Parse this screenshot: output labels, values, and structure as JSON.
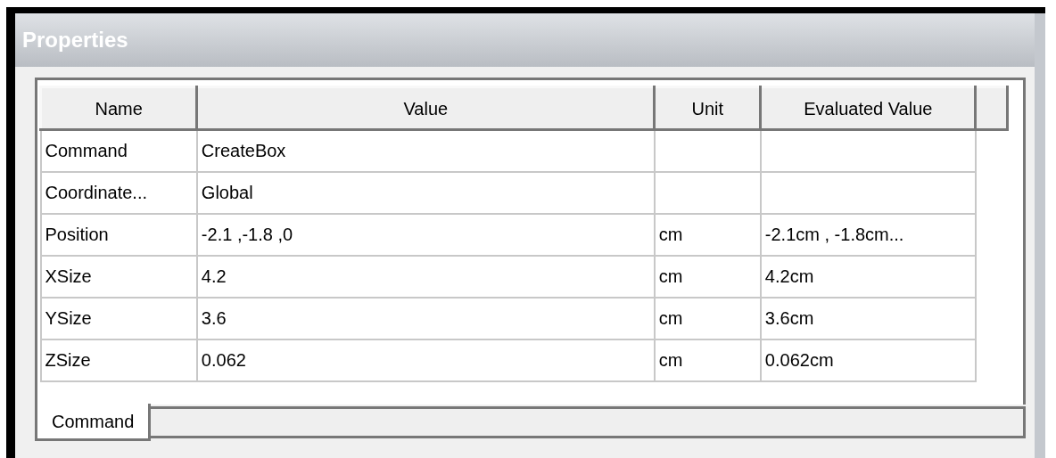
{
  "window": {
    "title": "Properties"
  },
  "table": {
    "columns": [
      "Name",
      "Value",
      "Unit",
      "Evaluated Value"
    ],
    "rows": [
      [
        "Command",
        "CreateBox",
        "",
        ""
      ],
      [
        "Coordinate...",
        "Global",
        "",
        ""
      ],
      [
        "Position",
        "-2.1 ,-1.8 ,0",
        "cm",
        "-2.1cm , -1.8cm..."
      ],
      [
        "XSize",
        "4.2",
        "cm",
        "4.2cm"
      ],
      [
        "YSize",
        "3.6",
        "cm",
        "3.6cm"
      ],
      [
        "ZSize",
        "0.062",
        "cm",
        "0.062cm"
      ]
    ]
  },
  "tabs": [
    {
      "label": "Command",
      "selected": true
    }
  ]
}
